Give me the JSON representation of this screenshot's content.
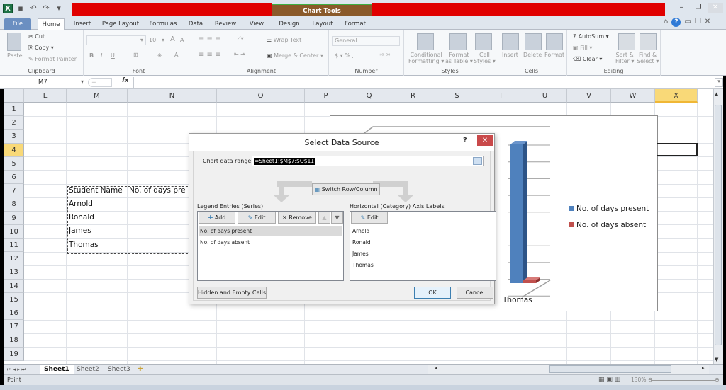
{
  "title_bar": {
    "chart_tools_label": "Chart Tools",
    "qat": [
      "excel-logo",
      "save",
      "undo",
      "redo",
      "customize"
    ]
  },
  "tabs": [
    {
      "label": "File"
    },
    {
      "label": "Home"
    },
    {
      "label": "Insert"
    },
    {
      "label": "Page Layout"
    },
    {
      "label": "Formulas"
    },
    {
      "label": "Data"
    },
    {
      "label": "Review"
    },
    {
      "label": "View"
    },
    {
      "label": "Design"
    },
    {
      "label": "Layout"
    },
    {
      "label": "Format"
    }
  ],
  "ribbon": {
    "clipboard": {
      "label": "Clipboard",
      "paste": "Paste",
      "cut": "Cut",
      "copy": "Copy ▾",
      "format_painter": "Format Painter"
    },
    "font": {
      "label": "Font",
      "size": "10"
    },
    "alignment": {
      "label": "Alignment",
      "wrap_text": "Wrap Text",
      "merge_center": "Merge & Center ▾"
    },
    "number": {
      "label": "Number",
      "format": "General"
    },
    "styles": {
      "label": "Styles",
      "conditional": [
        "Conditional",
        "Formatting ▾"
      ],
      "format_table": [
        "Format",
        "as Table ▾"
      ],
      "cell_styles": [
        "Cell",
        "Styles ▾"
      ]
    },
    "cells": {
      "label": "Cells",
      "insert": "Insert",
      "delete": "Delete",
      "format": "Format"
    },
    "editing": {
      "label": "Editing",
      "autosum": "AutoSum ▾",
      "fill": "Fill ▾",
      "clear": "Clear ▾",
      "sort": [
        "Sort &",
        "Filter ▾"
      ],
      "find": [
        "Find &",
        "Select ▾"
      ]
    }
  },
  "formula_bar": {
    "name_box": "M7",
    "fx": "fx",
    "value": ""
  },
  "sheet": {
    "columns": [
      "L",
      "M",
      "N",
      "O",
      "P",
      "Q",
      "R",
      "S",
      "T",
      "U",
      "V",
      "W",
      "X"
    ],
    "selected_column": "X",
    "rows": [
      "1",
      "2",
      "3",
      "4",
      "5",
      "6",
      "7",
      "8",
      "9",
      "10",
      "11",
      "12",
      "13",
      "14",
      "15",
      "16",
      "17",
      "18",
      "19"
    ],
    "selected_row": "4",
    "cells": {
      "M7": "Student Name",
      "N7": "No. of days pre",
      "M8": "Arnold",
      "M9": "Ronald",
      "M10": "James",
      "M11": "Thomas"
    }
  },
  "chart": {
    "visible_category": "Thomas",
    "legend": [
      {
        "label": "No. of days present",
        "color": "#4f81bd"
      },
      {
        "label": "No. of days absent",
        "color": "#c0504d"
      }
    ]
  },
  "chart_data": {
    "type": "bar",
    "title": "",
    "categories": [
      "Arnold",
      "Ronald",
      "James",
      "Thomas"
    ],
    "visible_categories": [
      "Thomas"
    ],
    "series": [
      {
        "name": "No. of days present",
        "values_visible": {
          "Thomas": "tall (value not labeled)"
        }
      },
      {
        "name": "No. of days absent",
        "values_visible": {
          "Thomas": "near zero (value not labeled)"
        }
      }
    ],
    "legend_position": "right",
    "grid": true,
    "style": "3-D clustered column"
  },
  "dialog": {
    "title": "Select Data Source",
    "help": "?",
    "close": "✕",
    "range_label": "Chart data range:",
    "range_value": "=Sheet1!$M$7:$O$11",
    "switch_label": "Switch Row/Column",
    "legend_header": "Legend Entries (Series)",
    "axis_header": "Horizontal (Category) Axis Labels",
    "add": "Add",
    "edit": "Edit",
    "remove": "Remove",
    "axis_edit": "Edit",
    "series": [
      "No. of days present",
      "No. of days absent"
    ],
    "selected_series": "No. of days present",
    "axis_labels": [
      "Arnold",
      "Ronald",
      "James",
      "Thomas"
    ],
    "hidden_empty": "Hidden and Empty Cells",
    "ok": "OK",
    "cancel": "Cancel"
  },
  "sheet_tabs": [
    "Sheet1",
    "Sheet2",
    "Sheet3"
  ],
  "active_sheet": "Sheet1",
  "status": {
    "mode": "Point",
    "zoom": "130%"
  }
}
